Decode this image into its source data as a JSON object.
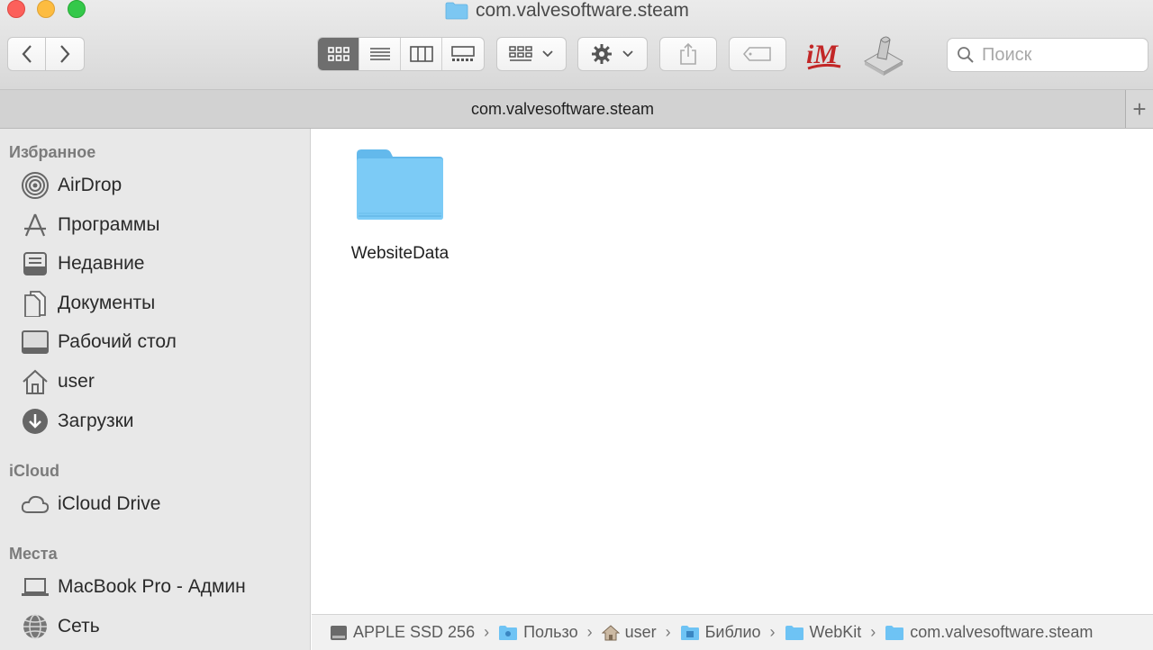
{
  "window": {
    "title": "com.valvesoftware.steam"
  },
  "toolbar": {
    "back_icon": "chevron-left-icon",
    "forward_icon": "chevron-right-icon",
    "view_modes": [
      "icon-view",
      "list-view",
      "column-view",
      "gallery-view"
    ],
    "active_view": "icon-view",
    "search_placeholder": "Поиск"
  },
  "tab": {
    "title": "com.valvesoftware.steam",
    "add_label": "+"
  },
  "sidebar": {
    "favorites_header": "Избранное",
    "favorites": [
      {
        "label": "AirDrop",
        "icon": "airdrop-icon"
      },
      {
        "label": "Программы",
        "icon": "applications-icon"
      },
      {
        "label": "Недавние",
        "icon": "recents-icon"
      },
      {
        "label": "Документы",
        "icon": "documents-icon"
      },
      {
        "label": "Рабочий стол",
        "icon": "desktop-icon"
      },
      {
        "label": "user",
        "icon": "home-icon"
      },
      {
        "label": "Загрузки",
        "icon": "downloads-icon"
      }
    ],
    "icloud_header": "iCloud",
    "icloud": [
      {
        "label": "iCloud Drive",
        "icon": "cloud-icon"
      }
    ],
    "places_header": "Места",
    "places": [
      {
        "label": "MacBook Pro - Админ",
        "icon": "laptop-icon"
      },
      {
        "label": "Сеть",
        "icon": "network-icon"
      }
    ]
  },
  "content": {
    "items": [
      {
        "name": "WebsiteData",
        "kind": "folder"
      }
    ]
  },
  "pathbar": {
    "crumbs": [
      {
        "label": "APPLE SSD 256",
        "icon": "drive-icon"
      },
      {
        "label": "Пользо",
        "icon": "users-folder-icon"
      },
      {
        "label": "user",
        "icon": "home-icon"
      },
      {
        "label": "Библио",
        "icon": "library-folder-icon"
      },
      {
        "label": "WebKit",
        "icon": "folder-icon"
      },
      {
        "label": "com.valvesoftware.steam",
        "icon": "folder-icon"
      }
    ],
    "separator": "›"
  },
  "colors": {
    "folder_blue": "#6ec3f4",
    "sidebar_bg": "#e8e8e8",
    "active_view_bg": "#6e6e6e"
  }
}
